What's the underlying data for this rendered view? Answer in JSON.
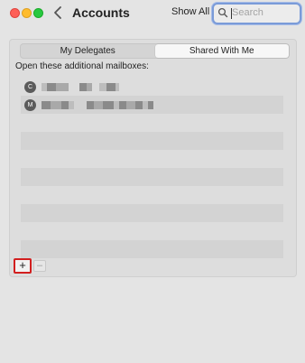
{
  "window": {
    "title": "Accounts",
    "show_all": "Show All"
  },
  "search": {
    "placeholder": "Search",
    "value": ""
  },
  "tabs": [
    {
      "label": "My Delegates",
      "active": false
    },
    {
      "label": "Shared With Me",
      "active": true
    }
  ],
  "section_label": "Open these additional mailboxes:",
  "mailboxes": [
    {
      "initial": "C"
    },
    {
      "initial": "M"
    }
  ],
  "buttons": {
    "add": "+",
    "remove": "–"
  },
  "colors": {
    "highlight": "#d21f1f",
    "search_focus": "#7a9bd8"
  }
}
